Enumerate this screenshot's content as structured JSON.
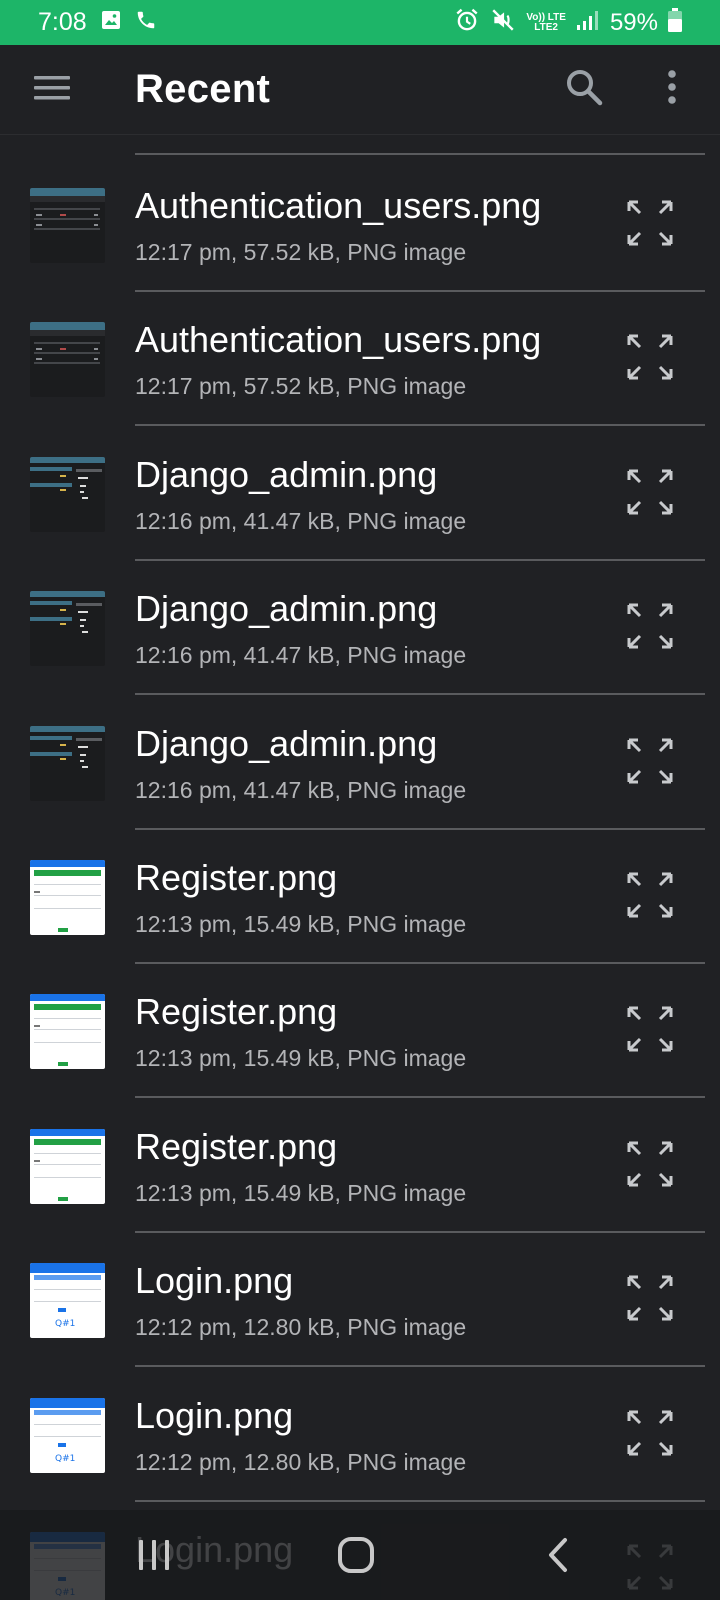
{
  "status_bar": {
    "time": "7:08",
    "network_label": "Vo)) LTE",
    "network_sub": "LTE2",
    "battery": "59%",
    "colors": {
      "background": "#1db568"
    }
  },
  "app_bar": {
    "title": "Recent",
    "icons": [
      "menu-icon",
      "search-icon",
      "more-vert-icon"
    ]
  },
  "files": [
    {
      "name": "Authentication_users.png",
      "meta": "12:17 pm, 57.52 kB, PNG image",
      "thumb": "dark"
    },
    {
      "name": "Authentication_users.png",
      "meta": "12:17 pm, 57.52 kB, PNG image",
      "thumb": "dark"
    },
    {
      "name": "Django_admin.png",
      "meta": "12:16 pm, 41.47 kB, PNG image",
      "thumb": "dark-admin"
    },
    {
      "name": "Django_admin.png",
      "meta": "12:16 pm, 41.47 kB, PNG image",
      "thumb": "dark-admin"
    },
    {
      "name": "Django_admin.png",
      "meta": "12:16 pm, 41.47 kB, PNG image",
      "thumb": "dark-admin"
    },
    {
      "name": "Register.png",
      "meta": "12:13 pm, 15.49 kB, PNG image",
      "thumb": "light-register"
    },
    {
      "name": "Register.png",
      "meta": "12:13 pm, 15.49 kB, PNG image",
      "thumb": "light-register"
    },
    {
      "name": "Register.png",
      "meta": "12:13 pm, 15.49 kB, PNG image",
      "thumb": "light-register"
    },
    {
      "name": "Login.png",
      "meta": "12:12 pm, 12.80 kB, PNG image",
      "thumb": "light-login"
    },
    {
      "name": "Login.png",
      "meta": "12:12 pm, 12.80 kB, PNG image",
      "thumb": "light-login"
    },
    {
      "name": "Login.png",
      "meta": "",
      "thumb": "light-login"
    }
  ],
  "nav_bar": {
    "icons": [
      "recents-icon",
      "home-icon",
      "back-icon"
    ]
  }
}
